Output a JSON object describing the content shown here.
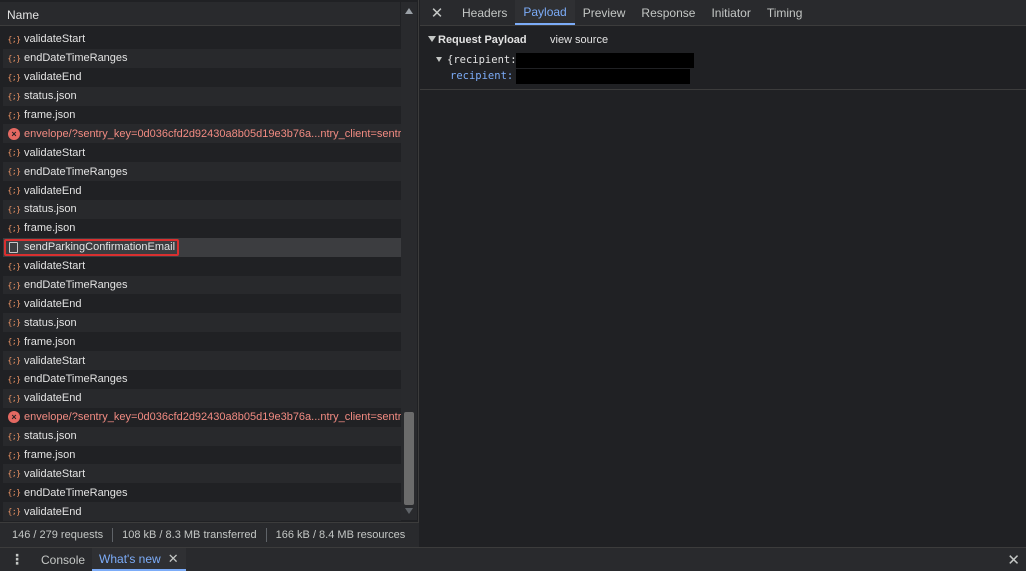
{
  "network": {
    "column_header": "Name",
    "rows": [
      {
        "type": "json",
        "name": "validateStart"
      },
      {
        "type": "json",
        "name": "endDateTimeRanges"
      },
      {
        "type": "json",
        "name": "validateEnd"
      },
      {
        "type": "json",
        "name": "status.json"
      },
      {
        "type": "json",
        "name": "frame.json"
      },
      {
        "type": "error",
        "name": "envelope/?sentry_key=0d036cfd2d92430a8b05d19e3b76a...ntry_client=sentr..."
      },
      {
        "type": "json",
        "name": "validateStart"
      },
      {
        "type": "json",
        "name": "endDateTimeRanges"
      },
      {
        "type": "json",
        "name": "validateEnd"
      },
      {
        "type": "json",
        "name": "status.json"
      },
      {
        "type": "json",
        "name": "frame.json"
      },
      {
        "type": "doc",
        "name": "sendParkingConfirmationEmail",
        "selected": true
      },
      {
        "type": "json",
        "name": "validateStart"
      },
      {
        "type": "json",
        "name": "endDateTimeRanges"
      },
      {
        "type": "json",
        "name": "validateEnd"
      },
      {
        "type": "json",
        "name": "status.json"
      },
      {
        "type": "json",
        "name": "frame.json"
      },
      {
        "type": "json",
        "name": "validateStart"
      },
      {
        "type": "json",
        "name": "endDateTimeRanges"
      },
      {
        "type": "json",
        "name": "validateEnd"
      },
      {
        "type": "error",
        "name": "envelope/?sentry_key=0d036cfd2d92430a8b05d19e3b76a...ntry_client=sentr..."
      },
      {
        "type": "json",
        "name": "status.json"
      },
      {
        "type": "json",
        "name": "frame.json"
      },
      {
        "type": "json",
        "name": "validateStart"
      },
      {
        "type": "json",
        "name": "endDateTimeRanges"
      },
      {
        "type": "json",
        "name": "validateEnd"
      }
    ],
    "status": {
      "requests": "146 / 279 requests",
      "transferred": "108 kB / 8.3 MB transferred",
      "resources": "166 kB / 8.4 MB resources"
    }
  },
  "details": {
    "tabs": [
      {
        "label": "Headers",
        "active": false
      },
      {
        "label": "Payload",
        "active": true
      },
      {
        "label": "Preview",
        "active": false
      },
      {
        "label": "Response",
        "active": false
      },
      {
        "label": "Initiator",
        "active": false
      },
      {
        "label": "Timing",
        "active": false
      }
    ],
    "payload": {
      "title": "Request Payload",
      "view_source": "view source",
      "tree_root": "{recipient: ",
      "tree_key": "recipient: "
    }
  },
  "drawer": {
    "tabs": [
      {
        "label": "Console",
        "active": false
      },
      {
        "label": "What's new",
        "active": true
      }
    ]
  },
  "colors": {
    "accent": "#7cacf8",
    "error": "#e46962",
    "json_icon": "#f29766",
    "highlight": "#d93030"
  }
}
